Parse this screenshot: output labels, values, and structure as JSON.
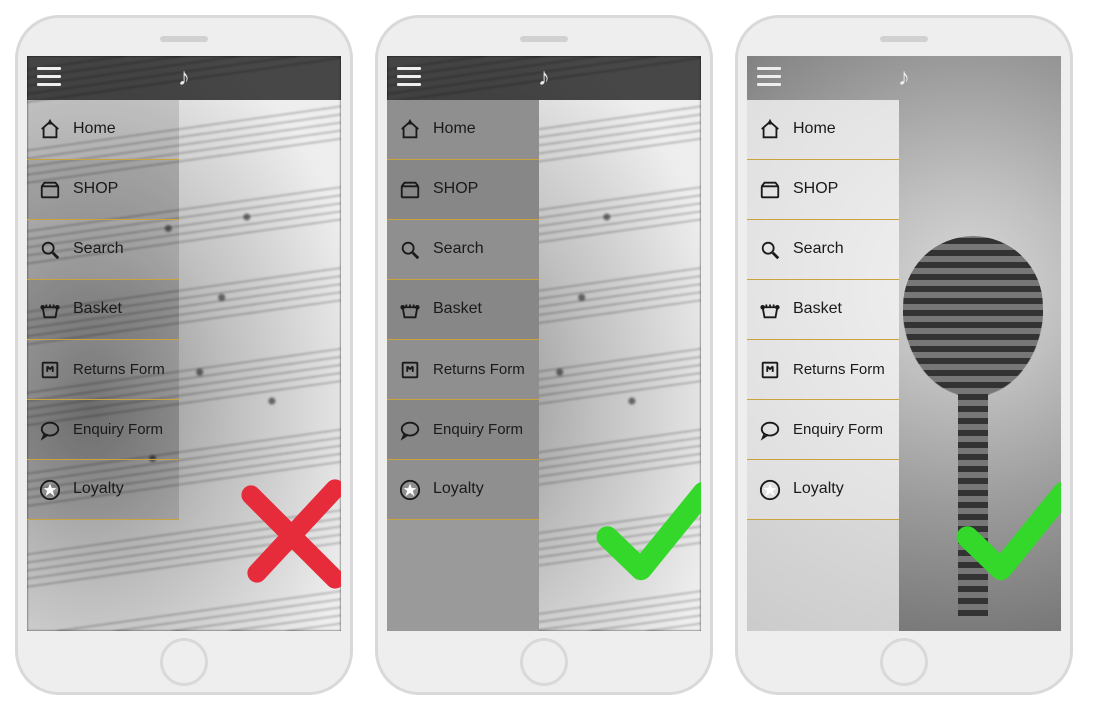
{
  "menu": {
    "items": [
      {
        "key": "home",
        "label": "Home",
        "icon": "home-icon"
      },
      {
        "key": "shop",
        "label": "SHOP",
        "icon": "shop-icon"
      },
      {
        "key": "search",
        "label": "Search",
        "icon": "search-icon"
      },
      {
        "key": "basket",
        "label": "Basket",
        "icon": "basket-icon"
      },
      {
        "key": "returns",
        "label": "Returns Form",
        "icon": "returns-icon",
        "multiline": true
      },
      {
        "key": "enquiry",
        "label": "Enquiry Form",
        "icon": "enquiry-icon",
        "multiline": true
      },
      {
        "key": "loyalty",
        "label": "Loyalty",
        "icon": "loyalty-icon"
      }
    ]
  },
  "header": {
    "logo_glyph": "♪"
  },
  "phones": [
    {
      "id": "phone-1",
      "drawer_style": "trans",
      "bg": "sheet",
      "topbar": "dark",
      "verdict": "cross"
    },
    {
      "id": "phone-2",
      "drawer_style": "gray",
      "bg": "sheet",
      "topbar": "dark",
      "verdict": "check"
    },
    {
      "id": "phone-3",
      "drawer_style": "light",
      "bg": "mic",
      "topbar": "light",
      "verdict": "check"
    }
  ],
  "colors": {
    "divider": "#caa33a",
    "cross": "#e62b3b",
    "check": "#34d82a"
  }
}
